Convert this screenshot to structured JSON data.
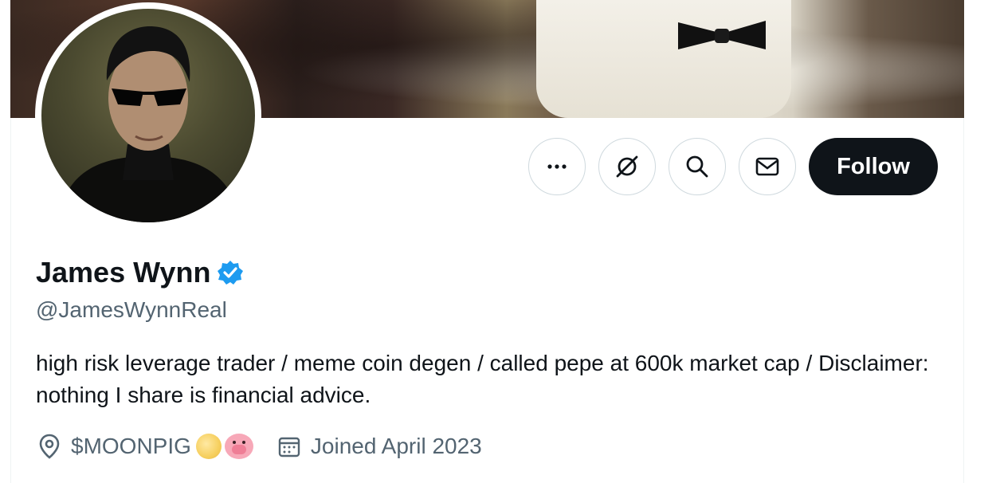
{
  "profile": {
    "name": "James Wynn",
    "handle": "@JamesWynnReal",
    "bio": "high risk leverage trader / meme coin degen / called pepe at 600k market cap / Disclaimer: nothing I share is financial advice.",
    "location": "$MOONPIG",
    "location_emojis": [
      "cookie-icon",
      "pig-face-icon"
    ],
    "joined": "Joined April 2023",
    "verified": true
  },
  "actions": {
    "more_icon": "more-icon",
    "grok_icon": "grok-icon",
    "search_icon": "search-icon",
    "message_icon": "message-icon",
    "follow_label": "Follow"
  },
  "colors": {
    "accent": "#1d9bf0",
    "follow_bg": "#0f1419",
    "secondary_text": "#536471",
    "border": "#cfd9de"
  }
}
